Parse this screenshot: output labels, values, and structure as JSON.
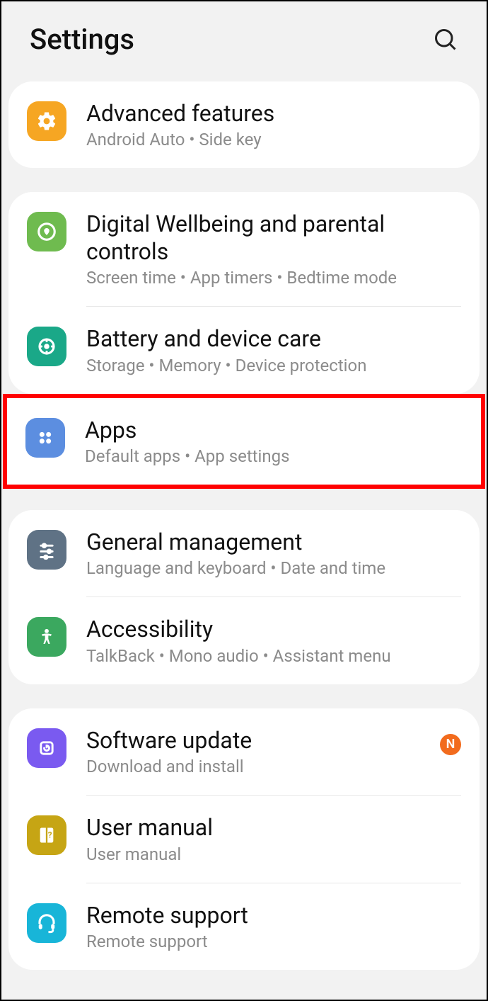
{
  "header": {
    "title": "Settings"
  },
  "groups": [
    {
      "items": [
        {
          "title": "Advanced features",
          "sub": "Android Auto  •  Side key"
        }
      ]
    },
    {
      "items": [
        {
          "title": "Digital Wellbeing and parental controls",
          "sub": "Screen time  •  App timers  •  Bedtime mode"
        },
        {
          "title": "Battery and device care",
          "sub": "Storage  •  Memory  •  Device protection"
        }
      ]
    },
    {
      "highlight": true,
      "items": [
        {
          "title": "Apps",
          "sub": "Default apps  •  App settings"
        }
      ]
    },
    {
      "items": [
        {
          "title": "General management",
          "sub": "Language and keyboard  •  Date and time"
        },
        {
          "title": "Accessibility",
          "sub": "TalkBack  •  Mono audio  •  Assistant menu"
        }
      ]
    },
    {
      "items": [
        {
          "title": "Software update",
          "sub": "Download and install",
          "badge": "N"
        },
        {
          "title": "User manual",
          "sub": "User manual"
        },
        {
          "title": "Remote support",
          "sub": "Remote support"
        }
      ]
    }
  ]
}
